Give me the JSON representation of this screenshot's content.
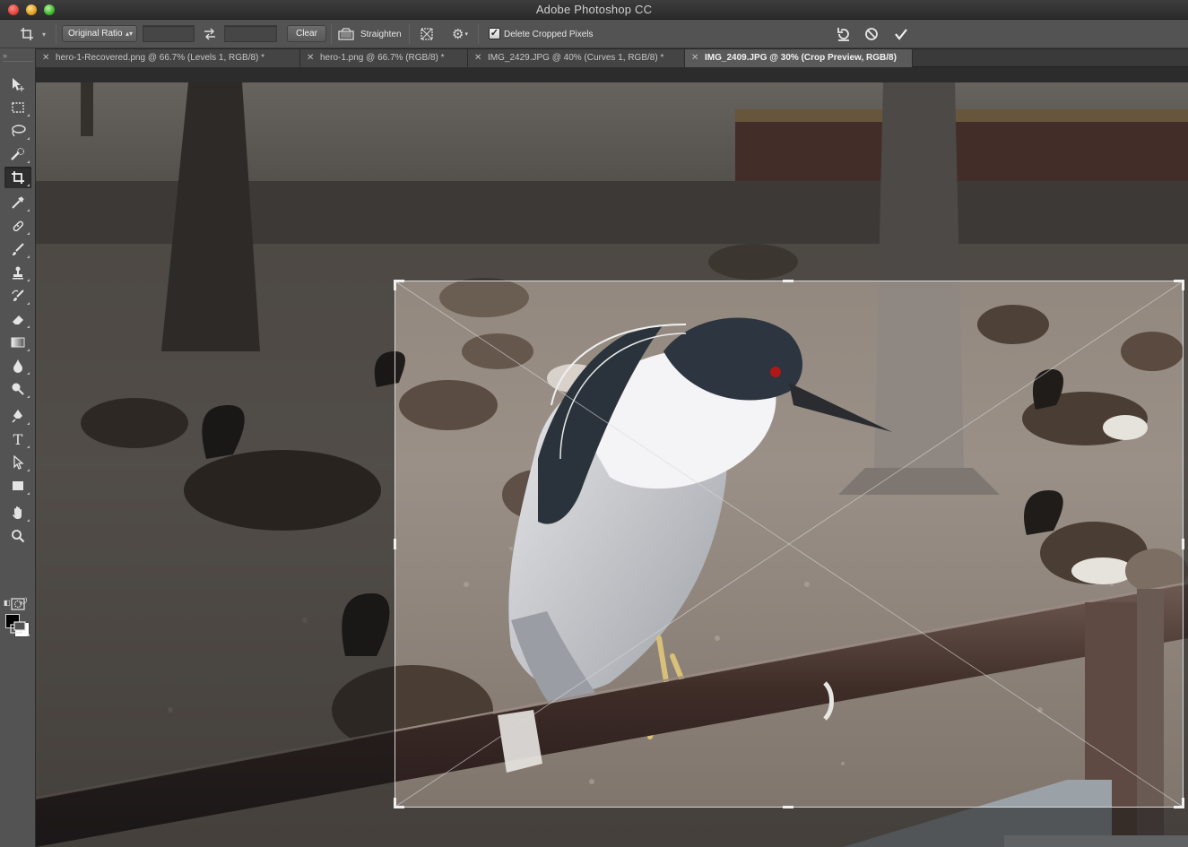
{
  "app": {
    "title": "Adobe Photoshop CC"
  },
  "options_bar": {
    "tool_icon": "crop-icon",
    "ratio_select": "Original Ratio",
    "width_value": "",
    "height_value": "",
    "clear_label": "Clear",
    "straighten_label": "Straighten",
    "delete_cropped_label": "Delete Cropped Pixels",
    "delete_cropped_checked": true,
    "reset_icon": "reset-icon",
    "cancel_icon": "cancel-icon",
    "commit_icon": "commit-checkmark-icon"
  },
  "tabs": [
    {
      "label": "hero-1-Recovered.png @ 66.7% (Levels 1, RGB/8) *",
      "active": false
    },
    {
      "label": "hero-1.png @ 66.7% (RGB/8) *",
      "active": false
    },
    {
      "label": "IMG_2429.JPG @ 40% (Curves 1, RGB/8) *",
      "active": false
    },
    {
      "label": "IMG_2409.JPG @ 30% (Crop Preview, RGB/8)",
      "active": true
    }
  ],
  "tools": [
    {
      "name": "move-tool",
      "icon": "move-icon",
      "selected": false
    },
    {
      "name": "marquee-tool",
      "icon": "rectangular-marquee-icon",
      "selected": false
    },
    {
      "name": "lasso-tool",
      "icon": "lasso-icon",
      "selected": false
    },
    {
      "name": "quick-selection-tool",
      "icon": "quick-selection-icon",
      "selected": false
    },
    {
      "name": "crop-tool",
      "icon": "crop-icon",
      "selected": true
    },
    {
      "name": "eyedropper-tool",
      "icon": "eyedropper-icon",
      "selected": false
    },
    {
      "name": "healing-brush-tool",
      "icon": "bandage-icon",
      "selected": false
    },
    {
      "name": "brush-tool",
      "icon": "brush-icon",
      "selected": false
    },
    {
      "name": "clone-stamp-tool",
      "icon": "stamp-icon",
      "selected": false
    },
    {
      "name": "history-brush-tool",
      "icon": "history-brush-icon",
      "selected": false
    },
    {
      "name": "eraser-tool",
      "icon": "eraser-icon",
      "selected": false
    },
    {
      "name": "gradient-tool",
      "icon": "gradient-icon",
      "selected": false
    },
    {
      "name": "blur-tool",
      "icon": "drop-icon",
      "selected": false
    },
    {
      "name": "dodge-tool",
      "icon": "dodge-icon",
      "selected": false
    },
    {
      "name": "pen-tool",
      "icon": "pen-icon",
      "selected": false
    },
    {
      "name": "type-tool",
      "icon": "type-icon",
      "selected": false
    },
    {
      "name": "path-selection-tool",
      "icon": "arrow-icon",
      "selected": false
    },
    {
      "name": "rectangle-tool",
      "icon": "rectangle-icon",
      "selected": false
    },
    {
      "name": "hand-tool",
      "icon": "hand-icon",
      "selected": false
    },
    {
      "name": "zoom-tool",
      "icon": "magnifier-icon",
      "selected": false
    }
  ],
  "colors": {
    "foreground": "#000000",
    "background": "#ffffff",
    "panel": "#535353",
    "canvas_shade": "#161616"
  }
}
